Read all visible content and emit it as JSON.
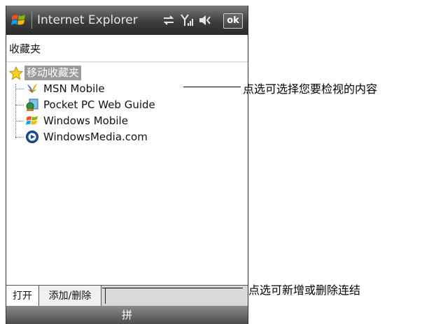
{
  "title_bar": {
    "app_title": "Internet Explorer",
    "ok_label": "ok",
    "icons": [
      "windows-start-flag",
      "connectivity-arrows",
      "signal-strength",
      "speaker-volume"
    ]
  },
  "folder_label": "收藏夹",
  "tree": {
    "root_label": "移动收藏夹",
    "items": [
      {
        "label": "MSN Mobile",
        "icon": "msn-butterfly"
      },
      {
        "label": "Pocket PC Web Guide",
        "icon": "web-guide-globe"
      },
      {
        "label": "Windows Mobile",
        "icon": "windows-flag"
      },
      {
        "label": "WindowsMedia.com",
        "icon": "windows-media"
      }
    ]
  },
  "tabs": {
    "open_label": "打开",
    "add_delete_label": "添加/删除"
  },
  "softkey": {
    "sip_label": "拼"
  },
  "callouts": {
    "tree_note": "点选可选择您要检视的内容",
    "tab_note": "点选可新增或删除连结"
  },
  "colors": {
    "title_bar": "#3d3d3d",
    "root_highlight": "#9a9a9a",
    "tab_bar": "#d9d9d9"
  }
}
